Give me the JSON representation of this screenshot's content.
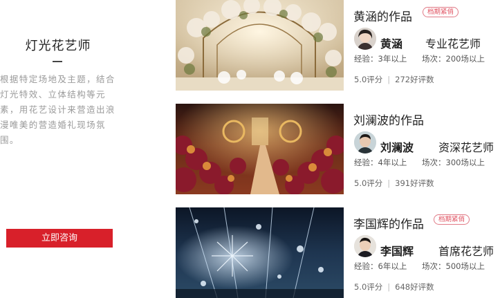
{
  "intro": {
    "title": "灯光花艺师",
    "description": "根据特定场地及主题，结合灯光特效、立体结构等元素，用花艺设计来营造出浪漫唯美的营造婚礼现场氛围。",
    "consult_button": "立即咨询"
  },
  "cards": [
    {
      "works_title": "黄涵的作品",
      "badge": "档期紧俏",
      "name": "黄涵",
      "role": "专业花艺师",
      "experience": "经验：3年以上",
      "sessions": "场次：200场以上",
      "score": "5.0评分",
      "reviews": "272好评数"
    },
    {
      "works_title": "刘澜波的作品",
      "badge": "",
      "name": "刘澜波",
      "role": "资深花艺师",
      "experience": "经验：4年以上",
      "sessions": "场次：300场以上",
      "score": "5.0评分",
      "reviews": "391好评数"
    },
    {
      "works_title": "李国辉的作品",
      "badge": "档期紧俏",
      "name": "李国辉",
      "role": "首席花艺师",
      "experience": "经验：6年以上",
      "sessions": "场次：500场以上",
      "score": "5.0评分",
      "reviews": "648好评数"
    }
  ],
  "colors": {
    "accent_red": "#d8202a",
    "badge_pink": "#e0505f"
  }
}
